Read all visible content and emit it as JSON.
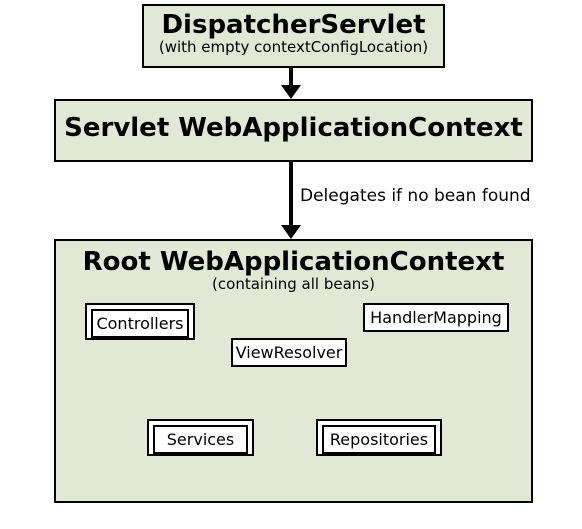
{
  "dispatcher": {
    "title": "DispatcherServlet",
    "sub": "(with empty contextConfigLocation)"
  },
  "servletContext": {
    "title": "Servlet WebApplicationContext"
  },
  "delegates": "Delegates if no bean found",
  "root": {
    "title": "Root WebApplicationContext",
    "sub": "(containing all beans)",
    "controllers": "Controllers",
    "viewresolver": "ViewResolver",
    "handlermapping": "HandlerMapping",
    "services": "Services",
    "repositories": "Repositories"
  }
}
